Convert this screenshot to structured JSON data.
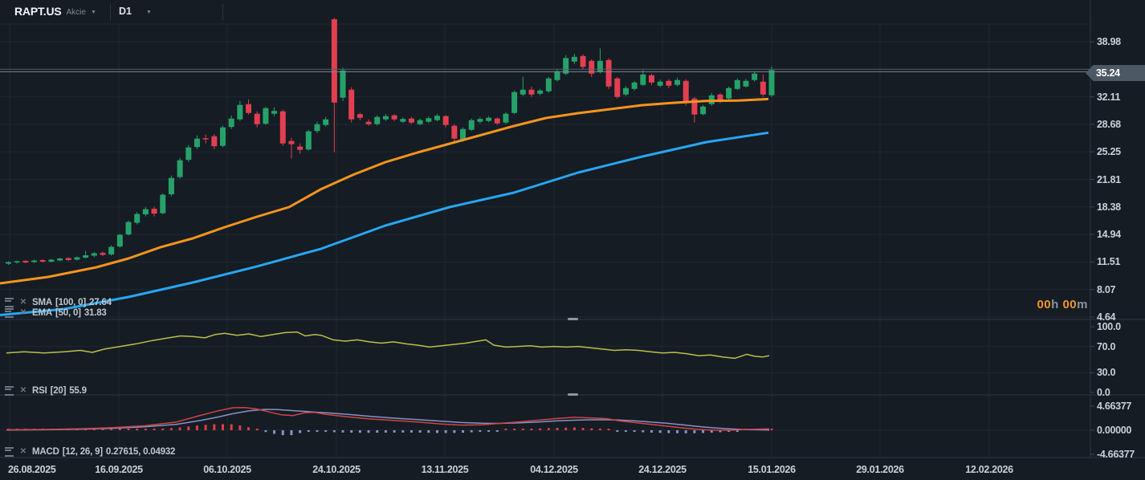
{
  "header": {
    "symbol": "RAPT.US",
    "market": "Akcie",
    "timeframe": "D1"
  },
  "icons": {
    "caret_glyph": "▼",
    "remove_glyph": "✕",
    "settings": "sliders-icon"
  },
  "legends": {
    "sma": {
      "name": "SMA",
      "params": "[100, 0]",
      "value": "27.64"
    },
    "ema": {
      "name": "EMA",
      "params": "[50, 0]",
      "value": "31.83"
    },
    "rsi": {
      "name": "RSI",
      "params": "[20]",
      "value": "55.9"
    },
    "macd": {
      "name": "MACD",
      "params": "[12, 26, 9]",
      "value": "0.27615,  0.04932"
    }
  },
  "countdown": {
    "hours": "00",
    "hours_unit": "h ",
    "minutes": "00",
    "minutes_unit": "m"
  },
  "price_tag": {
    "value": "35.24"
  },
  "axes": {
    "price_ticks": [
      "38.98",
      "32.11",
      "28.68",
      "25.25",
      "21.81",
      "18.38",
      "14.94",
      "11.51",
      "8.07",
      "4.64"
    ],
    "rsi_ticks": [
      "100.0",
      "70.0",
      "30.0",
      "0.0"
    ],
    "macd_ticks": [
      "4.66377",
      "0.00000",
      "-4.66377"
    ],
    "dates": [
      "26.08.2025",
      "16.09.2025",
      "06.10.2025",
      "24.10.2025",
      "13.11.2025",
      "04.12.2025",
      "24.12.2025",
      "15.01.2026",
      "29.01.2026",
      "12.02.2026"
    ]
  },
  "colors": {
    "background": "#151c24",
    "grid": "#1e2731",
    "separator": "#2b3644",
    "candle_up": "#26a269",
    "candle_down": "#e33f51",
    "ema50": "#f7941d",
    "sma100": "#27a6f3",
    "rsi_line": "#bdbe4a",
    "macd_line": "#d04545",
    "signal_line": "#8891c9",
    "hist_pos": "#e03c47",
    "hist_neg": "#8891c9",
    "price_line": "#7c8791",
    "price_line2": "#57616b",
    "tag_bg": "#4c5964",
    "accent_orange": "#f7941d"
  },
  "chart_data": {
    "type": "candlestick",
    "symbol": "RAPT.US",
    "timeframe": "D1",
    "price_axis_range": [
      4.64,
      38.98
    ],
    "current_price": 35.24,
    "price_lines": [
      35.55,
      35.24
    ],
    "candles": [
      [
        11.3,
        11.6,
        11.15,
        11.5
      ],
      [
        11.45,
        11.7,
        11.3,
        11.6
      ],
      [
        11.65,
        11.75,
        11.35,
        11.45
      ],
      [
        11.5,
        11.8,
        11.4,
        11.7
      ],
      [
        11.75,
        11.85,
        11.45,
        11.55
      ],
      [
        11.55,
        11.9,
        11.45,
        11.8
      ],
      [
        11.7,
        12.05,
        11.6,
        11.95
      ],
      [
        12.0,
        12.1,
        11.65,
        11.75
      ],
      [
        11.8,
        12.2,
        11.7,
        12.1
      ],
      [
        12.05,
        12.9,
        11.95,
        12.35
      ],
      [
        12.3,
        12.75,
        12.1,
        12.6
      ],
      [
        12.65,
        12.8,
        12.25,
        12.4
      ],
      [
        12.45,
        13.6,
        12.3,
        13.4
      ],
      [
        13.45,
        15.05,
        13.3,
        14.9
      ],
      [
        14.95,
        16.7,
        14.8,
        16.5
      ],
      [
        16.4,
        17.75,
        16.2,
        17.5
      ],
      [
        17.45,
        18.35,
        17.2,
        18.1
      ],
      [
        18.15,
        18.4,
        17.2,
        17.55
      ],
      [
        17.6,
        20.1,
        17.45,
        19.9
      ],
      [
        19.95,
        22.3,
        19.7,
        22.0
      ],
      [
        22.1,
        24.5,
        21.9,
        24.2
      ],
      [
        24.25,
        26.1,
        24.0,
        25.8
      ],
      [
        25.85,
        27.3,
        25.6,
        26.9
      ],
      [
        26.95,
        27.4,
        26.3,
        26.8
      ],
      [
        27.2,
        27.45,
        25.6,
        25.95
      ],
      [
        26.0,
        28.5,
        25.8,
        28.3
      ],
      [
        28.35,
        29.8,
        28.1,
        29.4
      ],
      [
        29.3,
        31.6,
        29.1,
        31.1
      ],
      [
        31.2,
        31.8,
        29.9,
        30.1
      ],
      [
        30.0,
        30.3,
        28.3,
        28.7
      ],
      [
        28.75,
        30.9,
        28.6,
        30.7
      ],
      [
        30.0,
        30.8,
        29.7,
        30.35
      ],
      [
        30.3,
        30.5,
        26.0,
        26.3
      ],
      [
        26.6,
        27.0,
        24.4,
        26.2
      ],
      [
        25.9,
        26.3,
        25.0,
        25.5
      ],
      [
        25.55,
        28.0,
        25.4,
        27.8
      ],
      [
        27.85,
        29.0,
        27.6,
        28.7
      ],
      [
        28.6,
        29.6,
        28.4,
        29.3
      ],
      [
        41.78,
        41.95,
        25.2,
        31.4
      ],
      [
        32.0,
        35.75,
        31.6,
        35.4
      ],
      [
        33.0,
        33.3,
        28.9,
        29.3
      ],
      [
        29.95,
        30.1,
        29.2,
        29.5
      ],
      [
        29.0,
        29.3,
        28.5,
        28.7
      ],
      [
        28.7,
        29.8,
        28.55,
        29.6
      ],
      [
        29.3,
        29.95,
        29.1,
        29.7
      ],
      [
        29.8,
        29.95,
        29.1,
        29.3
      ],
      [
        29.0,
        29.55,
        28.85,
        29.35
      ],
      [
        29.4,
        29.6,
        28.7,
        28.9
      ],
      [
        28.7,
        29.4,
        28.55,
        29.2
      ],
      [
        29.0,
        29.65,
        28.85,
        29.45
      ],
      [
        29.2,
        30.0,
        29.05,
        29.75
      ],
      [
        29.7,
        29.85,
        28.3,
        28.6
      ],
      [
        28.5,
        28.7,
        26.3,
        26.9
      ],
      [
        26.7,
        28.3,
        26.5,
        28.1
      ],
      [
        28.0,
        29.4,
        27.85,
        29.2
      ],
      [
        29.0,
        29.55,
        28.8,
        29.35
      ],
      [
        29.1,
        29.7,
        28.95,
        29.5
      ],
      [
        29.4,
        29.55,
        28.6,
        28.8
      ],
      [
        28.9,
        30.2,
        28.75,
        30.0
      ],
      [
        30.1,
        32.9,
        29.95,
        32.7
      ],
      [
        32.4,
        34.6,
        32.2,
        33.0
      ],
      [
        33.0,
        33.4,
        32.1,
        32.4
      ],
      [
        32.5,
        33.1,
        32.3,
        32.9
      ],
      [
        32.8,
        34.6,
        32.6,
        34.4
      ],
      [
        34.2,
        35.6,
        34.0,
        35.3
      ],
      [
        35.0,
        37.3,
        34.8,
        36.95
      ],
      [
        36.5,
        37.5,
        36.2,
        37.1
      ],
      [
        37.2,
        37.4,
        35.6,
        35.85
      ],
      [
        36.6,
        36.8,
        34.6,
        35.0
      ],
      [
        35.2,
        38.15,
        35.0,
        36.6
      ],
      [
        36.7,
        36.9,
        33.1,
        33.4
      ],
      [
        34.4,
        34.6,
        31.9,
        32.1
      ],
      [
        32.4,
        33.45,
        32.2,
        33.2
      ],
      [
        33.1,
        34.1,
        32.9,
        33.9
      ],
      [
        33.6,
        35.45,
        33.45,
        34.9
      ],
      [
        34.8,
        35.0,
        33.6,
        33.9
      ],
      [
        33.5,
        34.25,
        33.3,
        34.0
      ],
      [
        34.1,
        34.3,
        33.2,
        33.5
      ],
      [
        33.6,
        34.5,
        33.4,
        34.2
      ],
      [
        34.1,
        34.3,
        31.0,
        31.4
      ],
      [
        31.9,
        32.1,
        28.9,
        29.9
      ],
      [
        29.95,
        31.1,
        29.8,
        30.9
      ],
      [
        31.2,
        32.6,
        31.0,
        32.3
      ],
      [
        32.4,
        32.55,
        31.3,
        31.7
      ],
      [
        31.9,
        33.4,
        31.7,
        33.2
      ],
      [
        33.1,
        34.4,
        32.95,
        34.2
      ],
      [
        33.4,
        34.35,
        33.25,
        34.1
      ],
      [
        34.2,
        35.3,
        34.0,
        35.0
      ],
      [
        34.0,
        34.9,
        32.1,
        32.4
      ],
      [
        32.3,
        35.9,
        32.1,
        35.45
      ]
    ],
    "overlays": {
      "ema50": [
        [
          0,
          8.85
        ],
        [
          60,
          9.65
        ],
        [
          120,
          10.85
        ],
        [
          160,
          11.95
        ],
        [
          200,
          13.36
        ],
        [
          240,
          14.46
        ],
        [
          280,
          15.86
        ],
        [
          320,
          17.16
        ],
        [
          360,
          18.36
        ],
        [
          400,
          20.6
        ],
        [
          440,
          22.4
        ],
        [
          480,
          23.96
        ],
        [
          520,
          25.17
        ],
        [
          560,
          26.27
        ],
        [
          600,
          27.37
        ],
        [
          640,
          28.47
        ],
        [
          680,
          29.47
        ],
        [
          720,
          30.07
        ],
        [
          760,
          30.57
        ],
        [
          800,
          31.07
        ],
        [
          840,
          31.37
        ],
        [
          880,
          31.6
        ],
        [
          920,
          31.65
        ],
        [
          957,
          31.83
        ]
      ],
      "sma100": [
        [
          0,
          4.9
        ],
        [
          80,
          5.65
        ],
        [
          160,
          7.15
        ],
        [
          240,
          8.95
        ],
        [
          320,
          10.96
        ],
        [
          400,
          13.16
        ],
        [
          480,
          16.06
        ],
        [
          560,
          18.36
        ],
        [
          640,
          20.16
        ],
        [
          720,
          22.66
        ],
        [
          800,
          24.67
        ],
        [
          880,
          26.47
        ],
        [
          957,
          27.64
        ]
      ]
    },
    "rsi": {
      "range": [
        0,
        100
      ],
      "last": 55.9,
      "points": [
        [
          8,
          60
        ],
        [
          30,
          62
        ],
        [
          55,
          60
        ],
        [
          80,
          62
        ],
        [
          100,
          64
        ],
        [
          115,
          61
        ],
        [
          130,
          66
        ],
        [
          150,
          70
        ],
        [
          170,
          74
        ],
        [
          190,
          79
        ],
        [
          210,
          83
        ],
        [
          225,
          86
        ],
        [
          240,
          85
        ],
        [
          255,
          83
        ],
        [
          268,
          88
        ],
        [
          280,
          90
        ],
        [
          295,
          87
        ],
        [
          310,
          89
        ],
        [
          325,
          85
        ],
        [
          340,
          88
        ],
        [
          355,
          91
        ],
        [
          370,
          92
        ],
        [
          380,
          86
        ],
        [
          392,
          88
        ],
        [
          400,
          87
        ],
        [
          415,
          80
        ],
        [
          430,
          78
        ],
        [
          445,
          80
        ],
        [
          460,
          77
        ],
        [
          475,
          75
        ],
        [
          490,
          77
        ],
        [
          505,
          74
        ],
        [
          520,
          72
        ],
        [
          535,
          69
        ],
        [
          550,
          71
        ],
        [
          565,
          73
        ],
        [
          580,
          75
        ],
        [
          595,
          78
        ],
        [
          605,
          80
        ],
        [
          615,
          72
        ],
        [
          630,
          69
        ],
        [
          645,
          70
        ],
        [
          660,
          71
        ],
        [
          675,
          69
        ],
        [
          690,
          70
        ],
        [
          705,
          69
        ],
        [
          720,
          70
        ],
        [
          735,
          68
        ],
        [
          750,
          66
        ],
        [
          765,
          64
        ],
        [
          780,
          65
        ],
        [
          795,
          64
        ],
        [
          810,
          62
        ],
        [
          825,
          60
        ],
        [
          840,
          61
        ],
        [
          855,
          59
        ],
        [
          870,
          56
        ],
        [
          885,
          57
        ],
        [
          900,
          54
        ],
        [
          915,
          52
        ],
        [
          930,
          58
        ],
        [
          940,
          55
        ],
        [
          950,
          54
        ],
        [
          958,
          56
        ]
      ]
    },
    "macd": {
      "range": [
        -4.66377,
        4.66377
      ],
      "last_macd": 0.27615,
      "last_signal": 0.04932,
      "macd_points": [
        [
          8,
          0.1
        ],
        [
          60,
          0.15
        ],
        [
          100,
          0.3
        ],
        [
          140,
          0.5
        ],
        [
          180,
          0.85
        ],
        [
          220,
          1.6
        ],
        [
          250,
          2.9
        ],
        [
          270,
          3.7
        ],
        [
          290,
          4.35
        ],
        [
          305,
          4.4
        ],
        [
          320,
          4.1
        ],
        [
          335,
          3.55
        ],
        [
          350,
          3.0
        ],
        [
          365,
          2.85
        ],
        [
          380,
          3.4
        ],
        [
          392,
          3.45
        ],
        [
          405,
          3.1
        ],
        [
          430,
          2.65
        ],
        [
          460,
          2.2
        ],
        [
          490,
          1.9
        ],
        [
          520,
          1.6
        ],
        [
          550,
          1.2
        ],
        [
          575,
          1.0
        ],
        [
          600,
          1.05
        ],
        [
          620,
          1.3
        ],
        [
          645,
          1.6
        ],
        [
          670,
          1.95
        ],
        [
          695,
          2.3
        ],
        [
          715,
          2.5
        ],
        [
          735,
          2.4
        ],
        [
          755,
          2.25
        ],
        [
          770,
          1.85
        ],
        [
          790,
          1.5
        ],
        [
          810,
          1.15
        ],
        [
          830,
          0.8
        ],
        [
          850,
          0.45
        ],
        [
          870,
          0.15
        ],
        [
          890,
          0.0
        ],
        [
          910,
          0.0
        ],
        [
          930,
          0.15
        ],
        [
          945,
          0.22
        ],
        [
          958,
          0.276
        ]
      ],
      "signal_points": [
        [
          8,
          0.05
        ],
        [
          60,
          0.1
        ],
        [
          100,
          0.2
        ],
        [
          140,
          0.38
        ],
        [
          180,
          0.65
        ],
        [
          220,
          1.15
        ],
        [
          250,
          1.9
        ],
        [
          270,
          2.5
        ],
        [
          290,
          3.2
        ],
        [
          310,
          3.75
        ],
        [
          330,
          4.05
        ],
        [
          345,
          4.0
        ],
        [
          360,
          3.85
        ],
        [
          375,
          3.7
        ],
        [
          390,
          3.55
        ],
        [
          410,
          3.35
        ],
        [
          435,
          3.05
        ],
        [
          460,
          2.7
        ],
        [
          490,
          2.35
        ],
        [
          520,
          2.05
        ],
        [
          550,
          1.75
        ],
        [
          575,
          1.5
        ],
        [
          600,
          1.35
        ],
        [
          620,
          1.32
        ],
        [
          645,
          1.42
        ],
        [
          670,
          1.6
        ],
        [
          695,
          1.82
        ],
        [
          715,
          1.95
        ],
        [
          735,
          2.02
        ],
        [
          755,
          2.02
        ],
        [
          770,
          1.98
        ],
        [
          790,
          1.82
        ],
        [
          810,
          1.6
        ],
        [
          830,
          1.35
        ],
        [
          850,
          1.05
        ],
        [
          870,
          0.72
        ],
        [
          890,
          0.45
        ],
        [
          910,
          0.25
        ],
        [
          930,
          0.12
        ],
        [
          945,
          0.07
        ],
        [
          958,
          0.049
        ]
      ]
    }
  }
}
